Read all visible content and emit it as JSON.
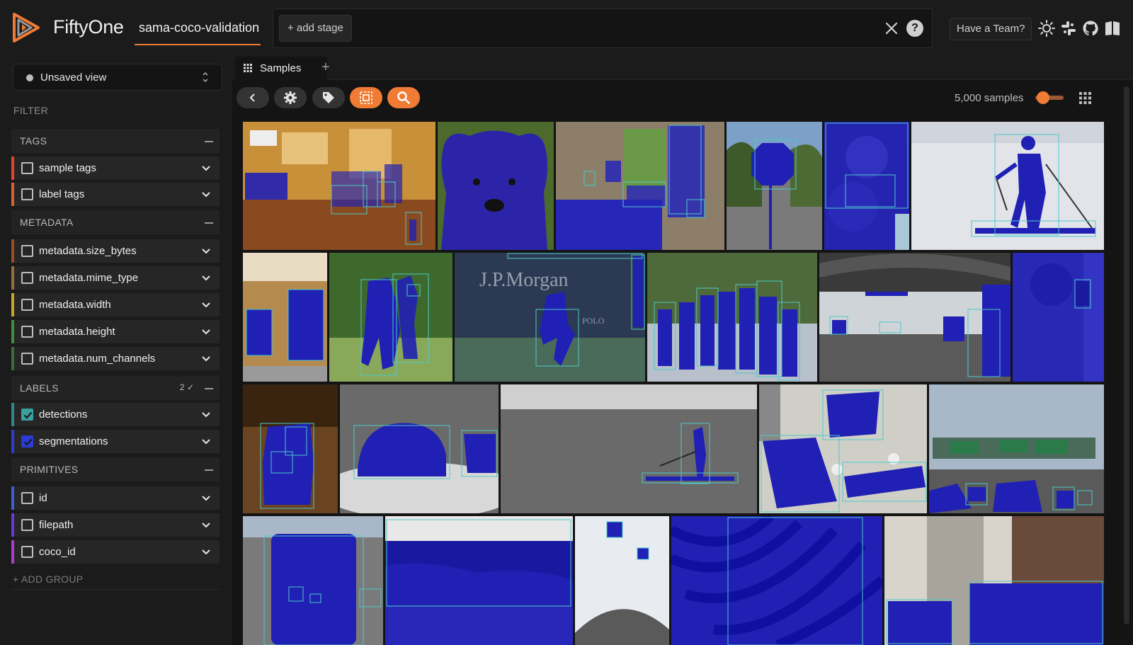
{
  "header": {
    "brand": "FiftyOne",
    "dataset": "sama-coco-validation",
    "add_stage": "+ add stage",
    "help": "?",
    "team": "Have a Team?",
    "icons": [
      "close-icon",
      "help-icon",
      "sun-icon",
      "slack-icon",
      "github-icon",
      "docs-icon"
    ]
  },
  "sidebar": {
    "view": "Unsaved view",
    "filter_title": "FILTER",
    "groups": {
      "tags": "TAGS",
      "metadata": "METADATA",
      "labels": "LABELS",
      "labels_count": "2",
      "primitives": "PRIMITIVES"
    },
    "fields": {
      "sample_tags": "sample tags",
      "label_tags": "label tags",
      "size_bytes": "metadata.size_bytes",
      "mime_type": "metadata.mime_type",
      "width": "metadata.width",
      "height": "metadata.height",
      "num_channels": "metadata.num_channels",
      "detections": "detections",
      "segmentations": "segmentations",
      "id": "id",
      "filepath": "filepath",
      "coco_id": "coco_id"
    },
    "field_colors": {
      "sample_tags": "#e5432c",
      "label_tags": "#d9642b",
      "size_bytes": "#9c4c23",
      "mime_type": "#9a6b3c",
      "width": "#c9a628",
      "height": "#3f8f3a",
      "num_channels": "#3b6b3a",
      "detections": "#2d8a8a",
      "segmentations": "#2b3bd6",
      "id": "#3d5fd6",
      "filepath": "#6a36d6",
      "coco_id": "#b03ad0"
    },
    "checked": [
      "detections",
      "segmentations"
    ],
    "add_group": "+ ADD GROUP"
  },
  "main": {
    "tab_label": "Samples",
    "tab_add": "+",
    "samples_count": "5,000 samples",
    "accent": "#f07b34",
    "mask_color": "#2020b4",
    "box_color": "#4cc9c9"
  }
}
